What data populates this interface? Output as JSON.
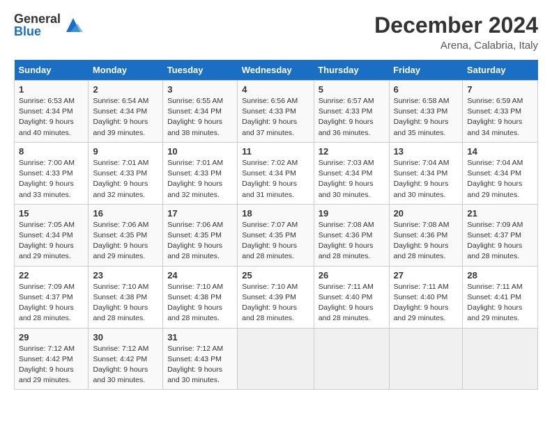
{
  "header": {
    "logo_general": "General",
    "logo_blue": "Blue",
    "month_title": "December 2024",
    "location": "Arena, Calabria, Italy"
  },
  "days_of_week": [
    "Sunday",
    "Monday",
    "Tuesday",
    "Wednesday",
    "Thursday",
    "Friday",
    "Saturday"
  ],
  "weeks": [
    [
      {
        "day": "1",
        "sunrise": "6:53 AM",
        "sunset": "4:34 PM",
        "daylight": "9 hours and 40 minutes."
      },
      {
        "day": "2",
        "sunrise": "6:54 AM",
        "sunset": "4:34 PM",
        "daylight": "9 hours and 39 minutes."
      },
      {
        "day": "3",
        "sunrise": "6:55 AM",
        "sunset": "4:34 PM",
        "daylight": "9 hours and 38 minutes."
      },
      {
        "day": "4",
        "sunrise": "6:56 AM",
        "sunset": "4:33 PM",
        "daylight": "9 hours and 37 minutes."
      },
      {
        "day": "5",
        "sunrise": "6:57 AM",
        "sunset": "4:33 PM",
        "daylight": "9 hours and 36 minutes."
      },
      {
        "day": "6",
        "sunrise": "6:58 AM",
        "sunset": "4:33 PM",
        "daylight": "9 hours and 35 minutes."
      },
      {
        "day": "7",
        "sunrise": "6:59 AM",
        "sunset": "4:33 PM",
        "daylight": "9 hours and 34 minutes."
      }
    ],
    [
      {
        "day": "8",
        "sunrise": "7:00 AM",
        "sunset": "4:33 PM",
        "daylight": "9 hours and 33 minutes."
      },
      {
        "day": "9",
        "sunrise": "7:01 AM",
        "sunset": "4:33 PM",
        "daylight": "9 hours and 32 minutes."
      },
      {
        "day": "10",
        "sunrise": "7:01 AM",
        "sunset": "4:33 PM",
        "daylight": "9 hours and 32 minutes."
      },
      {
        "day": "11",
        "sunrise": "7:02 AM",
        "sunset": "4:34 PM",
        "daylight": "9 hours and 31 minutes."
      },
      {
        "day": "12",
        "sunrise": "7:03 AM",
        "sunset": "4:34 PM",
        "daylight": "9 hours and 30 minutes."
      },
      {
        "day": "13",
        "sunrise": "7:04 AM",
        "sunset": "4:34 PM",
        "daylight": "9 hours and 30 minutes."
      },
      {
        "day": "14",
        "sunrise": "7:04 AM",
        "sunset": "4:34 PM",
        "daylight": "9 hours and 29 minutes."
      }
    ],
    [
      {
        "day": "15",
        "sunrise": "7:05 AM",
        "sunset": "4:34 PM",
        "daylight": "9 hours and 29 minutes."
      },
      {
        "day": "16",
        "sunrise": "7:06 AM",
        "sunset": "4:35 PM",
        "daylight": "9 hours and 29 minutes."
      },
      {
        "day": "17",
        "sunrise": "7:06 AM",
        "sunset": "4:35 PM",
        "daylight": "9 hours and 28 minutes."
      },
      {
        "day": "18",
        "sunrise": "7:07 AM",
        "sunset": "4:35 PM",
        "daylight": "9 hours and 28 minutes."
      },
      {
        "day": "19",
        "sunrise": "7:08 AM",
        "sunset": "4:36 PM",
        "daylight": "9 hours and 28 minutes."
      },
      {
        "day": "20",
        "sunrise": "7:08 AM",
        "sunset": "4:36 PM",
        "daylight": "9 hours and 28 minutes."
      },
      {
        "day": "21",
        "sunrise": "7:09 AM",
        "sunset": "4:37 PM",
        "daylight": "9 hours and 28 minutes."
      }
    ],
    [
      {
        "day": "22",
        "sunrise": "7:09 AM",
        "sunset": "4:37 PM",
        "daylight": "9 hours and 28 minutes."
      },
      {
        "day": "23",
        "sunrise": "7:10 AM",
        "sunset": "4:38 PM",
        "daylight": "9 hours and 28 minutes."
      },
      {
        "day": "24",
        "sunrise": "7:10 AM",
        "sunset": "4:38 PM",
        "daylight": "9 hours and 28 minutes."
      },
      {
        "day": "25",
        "sunrise": "7:10 AM",
        "sunset": "4:39 PM",
        "daylight": "9 hours and 28 minutes."
      },
      {
        "day": "26",
        "sunrise": "7:11 AM",
        "sunset": "4:40 PM",
        "daylight": "9 hours and 28 minutes."
      },
      {
        "day": "27",
        "sunrise": "7:11 AM",
        "sunset": "4:40 PM",
        "daylight": "9 hours and 29 minutes."
      },
      {
        "day": "28",
        "sunrise": "7:11 AM",
        "sunset": "4:41 PM",
        "daylight": "9 hours and 29 minutes."
      }
    ],
    [
      {
        "day": "29",
        "sunrise": "7:12 AM",
        "sunset": "4:42 PM",
        "daylight": "9 hours and 29 minutes."
      },
      {
        "day": "30",
        "sunrise": "7:12 AM",
        "sunset": "4:42 PM",
        "daylight": "9 hours and 30 minutes."
      },
      {
        "day": "31",
        "sunrise": "7:12 AM",
        "sunset": "4:43 PM",
        "daylight": "9 hours and 30 minutes."
      },
      null,
      null,
      null,
      null
    ]
  ]
}
